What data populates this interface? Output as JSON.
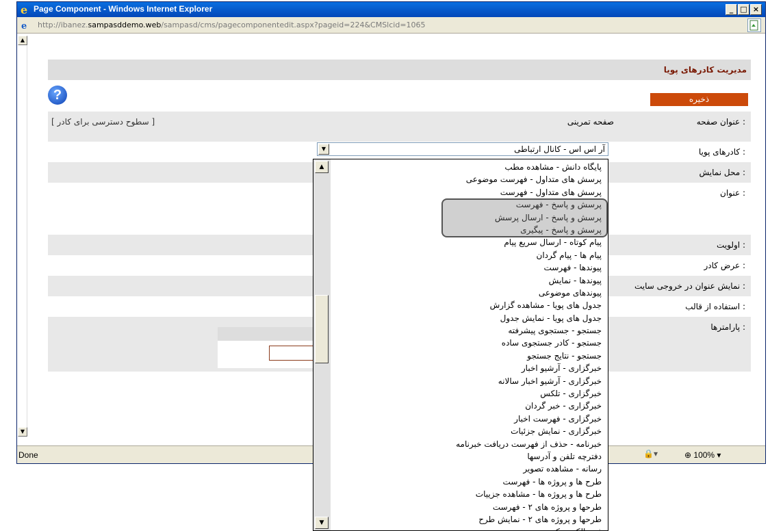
{
  "window": {
    "title": "Page Component - Windows Internet Explorer",
    "url_prefix": "http://ibanez.",
    "url_domain": "sampasddemo.web",
    "url_path": "/sampasd/cms/pagecomponentedit.aspx?pageid=224&CMSlcid=1065"
  },
  "header": {
    "title": "مدیریت کادرهای پویا"
  },
  "toolbar": {
    "save_label": "ذخیره"
  },
  "form": {
    "page_title_label": "عنوان صفحه :",
    "page_title_value": "صفحه تمرینی",
    "access_link": "[ سطوح دسترسی برای کادر ]",
    "dynamic_frames_label": "کادرهای پویا :",
    "dynamic_frames_value": "آر اس اس - کانال ارتباطی",
    "display_location_label": "محل نمایش :",
    "title_label": "عنوان :",
    "priority_label": "اولویت :",
    "frame_width_label": "عرض کادر :",
    "show_title_label": "نمایش عنوان در خروجی سایت :",
    "use_template_label": "استفاده از قالب :",
    "parameters_label": "پارامترها :"
  },
  "dropdown": {
    "options": [
      "پایگاه دانش - مشاهده مطب",
      "پرسش های متداول - فهرست موضوعی",
      "پرسش های متداول - فهرست",
      "پرسش و پاسخ - فهرست",
      "پرسش و پاسخ - ارسال پرسش",
      "پرسش و پاسخ - پیگیری",
      "پیام کوتاه - ارسال سریع پیام",
      "پیام ها - پیام گردان",
      "پیوندها - فهرست",
      "پیوندها - نمایش",
      "پیوندهای موضوعی",
      "جدول های پویا - مشاهده گزارش",
      "جدول های پویا - نمایش جدول",
      "جستجو - جستجوی پیشرفته",
      "جستجو - کادر جستجوی ساده",
      "جستجو - نتایج جستجو",
      "خبرگزاری - آرشیو اخبار",
      "خبرگزاری - آرشیو اخبار سالانه",
      "خبرگزاری - تلکس",
      "خبرگزاری - خبر گردان",
      "خبرگزاری - فهرست اخبار",
      "خبرگزاری - نمایش جزئیات",
      "خبرنامه - حذف از فهرست دریافت خبرنامه",
      "دفترچه تلفن و آدرسها",
      "رسانه - مشاهده تصویر",
      "طرح ها و پروژه ها - فهرست",
      "طرح ها و پروژه ها - مشاهده جزییات",
      "طرحها و پروژه های ۲ - فهرست",
      "طرحها و پروژه های ۲ - نمایش طرح",
      "فرم الکترونیکی"
    ],
    "highlighted_range": [
      3,
      5
    ]
  },
  "status": {
    "text": "Done",
    "zoom": "100%"
  }
}
